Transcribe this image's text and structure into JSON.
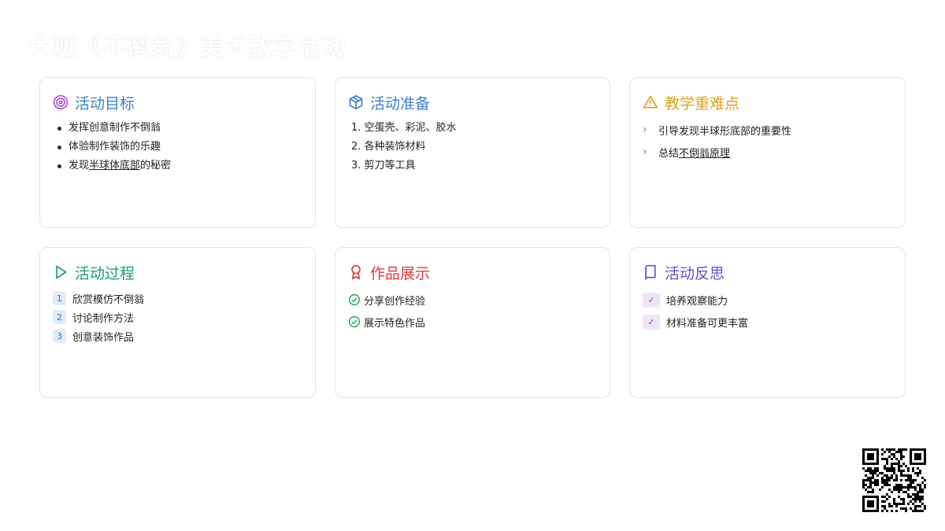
{
  "page": {
    "title": "大班《不倒翁》美术教学活动"
  },
  "colors": {
    "goals": "#3d7fd0",
    "goals_icon": "#a855c9",
    "prep": "#3d7fd0",
    "key": "#d9a41a",
    "process": "#1f9d6b",
    "showcase": "#d93b3b",
    "reflect": "#5a55c9"
  },
  "cards": {
    "goals": {
      "icon": "target-icon",
      "title": "活动目标",
      "items": [
        {
          "before": "发挥创意制作不倒翁",
          "underline": "",
          "after": ""
        },
        {
          "before": "体验制作装饰的乐趣",
          "underline": "",
          "after": ""
        },
        {
          "before": "发现",
          "underline": "半球体底部",
          "after": "的秘密"
        }
      ]
    },
    "prep": {
      "icon": "box-icon",
      "title": "活动准备",
      "items": [
        "1. 空蛋壳、彩泥、胶水",
        "2. 各种装饰材料",
        "3. 剪刀等工具"
      ]
    },
    "key": {
      "icon": "warning-icon",
      "title": "教学重难点",
      "items": [
        {
          "before": "引导发现半球形底部的重要性",
          "underline": ""
        },
        {
          "before": "总结",
          "underline": "不倒翁原理"
        }
      ]
    },
    "process": {
      "icon": "play-icon",
      "title": "活动过程",
      "steps": [
        {
          "num": "1",
          "text": "欣赏模仿不倒翁"
        },
        {
          "num": "2",
          "text": "讨论制作方法"
        },
        {
          "num": "3",
          "text": "创意装饰作品"
        }
      ]
    },
    "showcase": {
      "icon": "award-icon",
      "title": "作品展示",
      "items": [
        "分享创作经验",
        "展示特色作品"
      ]
    },
    "reflect": {
      "icon": "book-icon",
      "title": "活动反思",
      "tick": "✓",
      "items": [
        "培养观察能力",
        "材料准备可更丰富"
      ]
    }
  },
  "qr": {
    "icon": "qr-code-icon"
  }
}
